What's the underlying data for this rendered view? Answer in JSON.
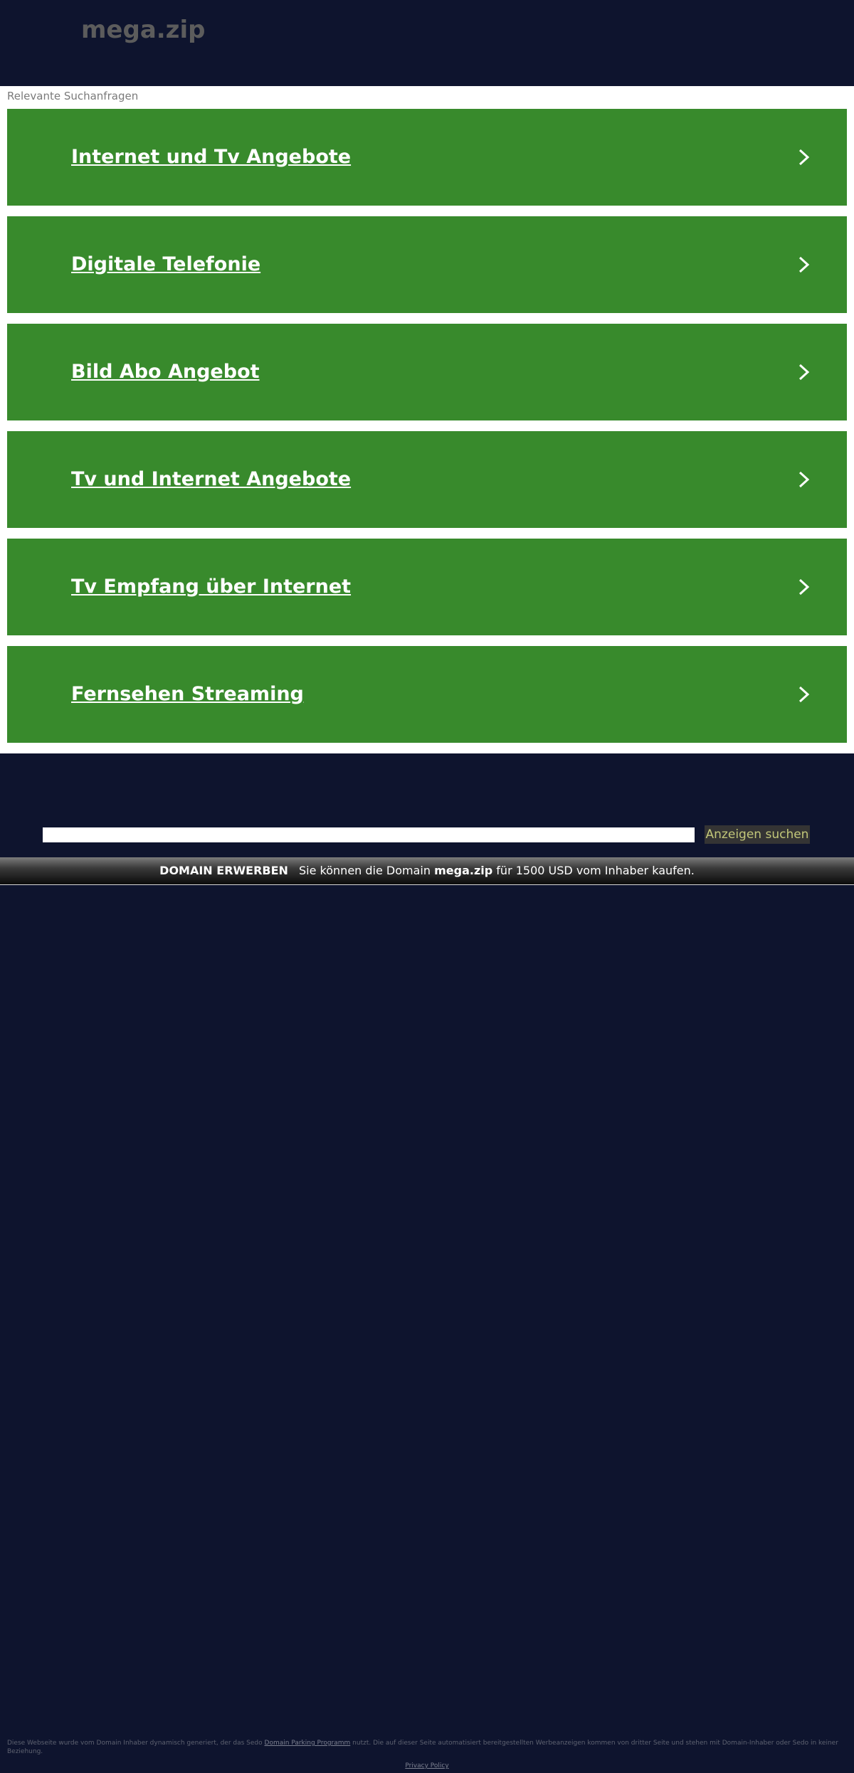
{
  "header": {
    "logo": "mega.zip"
  },
  "results": {
    "title": "Relevante Suchanfragen",
    "items": [
      {
        "label": "Internet und Tv Angebote"
      },
      {
        "label": "Digitale Telefonie"
      },
      {
        "label": "Bild Abo Angebot"
      },
      {
        "label": "Tv und Internet Angebote"
      },
      {
        "label": "Tv Empfang über Internet"
      },
      {
        "label": "Fernsehen Streaming"
      }
    ]
  },
  "search": {
    "input_value": "",
    "button_label": "Anzeigen suchen"
  },
  "domain_bar": {
    "buy_label": "DOMAIN ERWERBEN",
    "text_before": "Sie können die Domain",
    "domain": "mega.zip",
    "text_after": "für 1500 USD vom Inhaber kaufen."
  },
  "footer": {
    "text_before": "Diese Webseite wurde vom Domain Inhaber dynamisch generiert, der das Sedo",
    "link_label": "Domain Parking Programm",
    "text_after": "nutzt. Die auf dieser Seite automatisiert bereitgestellten Werbeanzeigen kommen von dritter Seite und stehen mit Domain-Inhaber oder Sedo in keiner Beziehung.",
    "privacy_label": "Privacy Policy"
  },
  "colors": {
    "background": "#0e142e",
    "link_green": "#388a2c",
    "button_bg": "#343434",
    "button_text": "#c2c77a",
    "logo": "#5c5c5c"
  },
  "icons": {
    "link_chevron": "chevron-right-icon"
  }
}
